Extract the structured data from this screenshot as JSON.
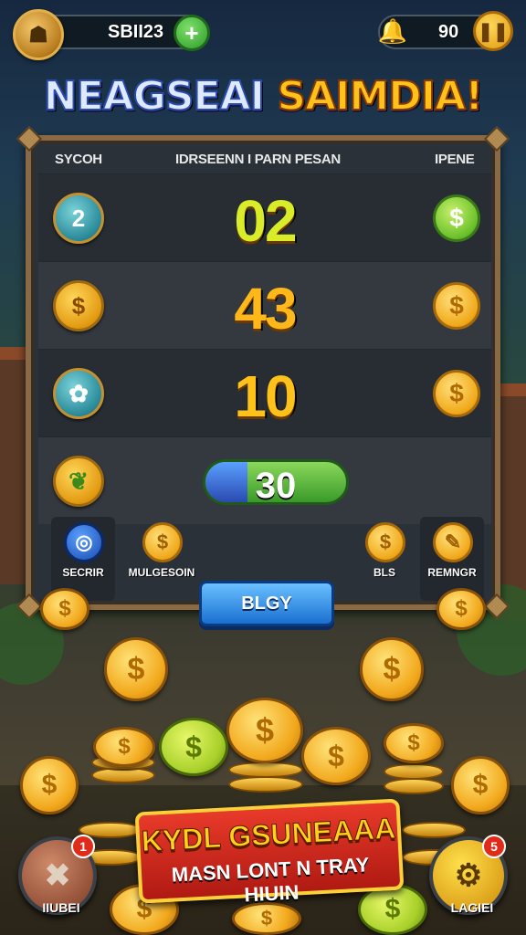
{
  "hud": {
    "currency_value": "SBII23",
    "plus_icon": "plus-icon",
    "lives_value": "90",
    "pause_icon": "pause-icon"
  },
  "title": {
    "part1": "NEAGSEAI",
    "part2": "SAIMDIA!"
  },
  "board": {
    "headers": {
      "left": "SYCOH",
      "center": "IDRSEENN I PARN PESAN",
      "right": "IPENE"
    },
    "rows": [
      {
        "icon_label": "2",
        "value": "02",
        "value_color": "#d8ec2a",
        "coin": "$"
      },
      {
        "icon_label": "$",
        "value": "43",
        "value_color": "#ffb81a",
        "coin": "$"
      },
      {
        "icon_label": "✿",
        "value": "10",
        "value_color": "#ffc21a",
        "coin": "$"
      },
      {
        "icon_label": "❦",
        "progress_value": "30",
        "progress_fraction": 0.3
      }
    ],
    "slots": [
      {
        "label": "SECRIR",
        "icon": "◎"
      },
      {
        "label": "MULGESOIN",
        "icon": "$"
      },
      {
        "label": "BLS",
        "icon": "$"
      },
      {
        "label": "REMNGR",
        "icon": "✎"
      }
    ]
  },
  "play_button": "BLGY",
  "banner": {
    "line1": "KYDL GSUNEAAA",
    "line2": "MASN LONT N TRAY HIUIN"
  },
  "corner_left": {
    "label": "IIUBEI",
    "badge": "1"
  },
  "corner_right": {
    "label": "LAGIEI",
    "badge": "5"
  }
}
